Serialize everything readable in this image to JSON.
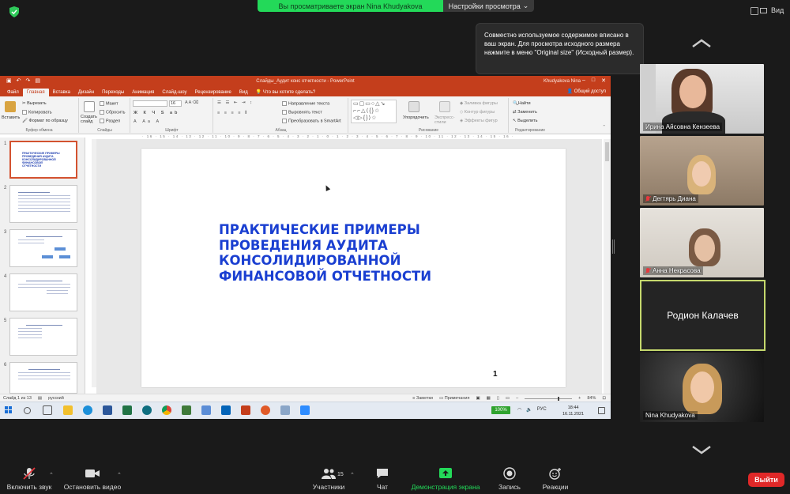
{
  "zoom": {
    "share_banner": "Вы просматриваете экран Nina Khudyakova",
    "view_settings": "Настройки просмотра",
    "view_label": "Вид",
    "tooltip": "Совместно используемое содержимое вписано в ваш экран. Для просмотра исходного размера нажмите в меню \"Original size\" (Исходный размер).",
    "participants": [
      {
        "name": "Ирина Айсовна Кензеева",
        "muted": false
      },
      {
        "name": "Дегтярь Диана",
        "muted": true
      },
      {
        "name": "Анна Некрасова",
        "muted": true
      },
      {
        "name": "Родион Калачев",
        "muted": false,
        "video": false
      },
      {
        "name": "Nina Khudyakova",
        "muted": false
      }
    ],
    "toolbar": {
      "unmute": "Включить звук",
      "start_video": "Остановить видео",
      "participants": "Участники",
      "participants_count": "15",
      "chat": "Чат",
      "share_screen": "Демонстрация экрана",
      "record": "Запись",
      "reactions": "Реакции",
      "leave": "Выйти"
    },
    "accent_green": "#23d959",
    "leave_red": "#e02828"
  },
  "ppt": {
    "window_title": "Слайды_Аудит конс отчетности - PowerPoint",
    "user": "Khudyakova Nina",
    "tabs": [
      "Файл",
      "Главная",
      "Вставка",
      "Дизайн",
      "Переходы",
      "Анимация",
      "Слайд-шоу",
      "Рецензирование",
      "Вид"
    ],
    "tell_me": "Что вы хотите сделать?",
    "share": "Общий доступ",
    "ribbon": {
      "paste": "Вставить",
      "cut": "Вырезать",
      "copy": "Копировать",
      "format_painter": "Формат по образцу",
      "clipboard": "Буфер обмена",
      "new_slide": "Создать слайд",
      "layout": "Макет",
      "reset": "Сбросить",
      "section": "Раздел",
      "slides": "Слайды",
      "font_size": "16",
      "font": "Шрифт",
      "text_direction": "Направление текста",
      "align_text": "Выровнять текст",
      "smartart": "Преобразовать в SmartArt",
      "paragraph": "Абзац",
      "arrange": "Упорядочить",
      "quick_styles": "Экспресс-стили",
      "shape_fill": "Заливка фигуры",
      "shape_outline": "Контур фигуры",
      "shape_effects": "Эффекты фигур",
      "drawing": "Рисование",
      "find": "Найти",
      "replace": "Заменить",
      "select": "Выделить",
      "editing": "Редактирование"
    },
    "ruler_text": "· 16 · 15 · 14 · 13 · 12 · 11 · 10 · 9 · 8 · 7 · 6 · 5 · 4 · 3 · 2 · 1 · 0 · 1 · 2 · 3 · 4 · 5 · 6 · 7 · 8 · 9 · 10 · 11 · 12 · 13 · 14 · 15 · 16 ·",
    "thumbnails": [
      "1",
      "2",
      "3",
      "4",
      "5",
      "6"
    ],
    "thumb1_title": "ПРАКТИЧЕСКИЕ ПРИМЕРЫ ПРОВЕДЕНИЯ АУДИТА КОНСОЛИДИРОВАННОЙ ФИНАНСОВОЙ ОТЧЕТНОСТИ",
    "slide_title": "ПРАКТИЧЕСКИЕ ПРИМЕРЫ ПРОВЕДЕНИЯ АУДИТА КОНСОЛИДИРОВАННОЙ ФИНАНСОВОЙ ОТЧЕТНОСТИ",
    "slide_number": "1",
    "status": {
      "slide_of": "Слайд 1 из 13",
      "language": "русский",
      "notes": "Заметки",
      "comments": "Примечания",
      "zoom": "84%"
    },
    "title_color": "#1a3fd1",
    "brand_color": "#c43e1c"
  },
  "taskbar": {
    "battery": "100%",
    "lang": "РУС",
    "time": "18:44",
    "date": "16.11.2021"
  }
}
